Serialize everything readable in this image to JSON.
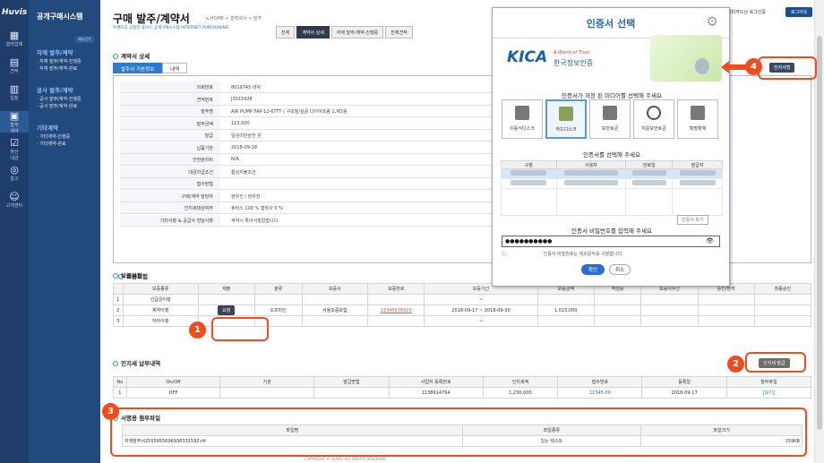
{
  "iconbar": {
    "logo": "Huvis",
    "items": [
      "협력업체",
      "견적",
      "입찰",
      "발주\n계약",
      "정산\n대금",
      "알고",
      "고객센터"
    ]
  },
  "sidenav": {
    "title": "공개구매시스템",
    "menu_btn": "메뉴닫기",
    "groups": [
      {
        "title": "자재 발주/계약",
        "items": [
          "· 자재 발주/계약-진행중",
          "· 자재 발주/계약-완료"
        ]
      },
      {
        "title": "공사 발주/계약",
        "items": [
          "· 공사 발주/계약-진행중",
          "· 공사 발주/계약-완료"
        ]
      },
      {
        "title": "기타계약",
        "items": [
          "· 기타계약-진행중",
          "· 기타계약-완료"
        ]
      }
    ]
  },
  "header": {
    "title": "구매 발주/계약서",
    "breadcrumb": "⌂ HOME > 협력회사 > 발주",
    "subtitle": "투명하고 공정한 휴비스 공개구매시스템 INTERNET PURCHASING",
    "tabs": [
      "전체",
      "계약서 상세",
      "자재 발주/계약-진행중",
      "전체견적"
    ],
    "user": "남미카드님",
    "user_suffix": "로그인중",
    "logout": "로그아웃"
  },
  "detail": {
    "section": "계약서 상세",
    "subtabs": [
      "발주서 기본정보",
      "내역"
    ],
    "rows": [
      {
        "k": "의뢰번호",
        "v": "8019745   내자"
      },
      {
        "k": "견적번호",
        "v": "J2015928"
      },
      {
        "k": "발주명",
        "v": "AIR PUMP FAP-12-6TTT ( 구모빌/실굴 다이아프람 1,제3용"
      },
      {
        "k": "발주금액",
        "v": "123,000"
      },
      {
        "k": "발급",
        "v": "일심이만삼천 원"
      },
      {
        "k": "납품기한",
        "v": "2018-09-18"
      },
      {
        "k": "안전관리비",
        "v": "N/A"
      },
      {
        "k": "대금지급조건",
        "v": "통상지불조건"
      },
      {
        "k": "접수방법",
        "v": ""
      },
      {
        "k": "구매/계약 담당자",
        "v": "현우진 / 현우진"
      },
      {
        "k": "인지세대상여부",
        "v": "휴비스 100 % 협력사 0 %"
      },
      {
        "k": "기타사항 & 공급사 전달사항",
        "v": "계약시 특이사항없습니다."
      }
    ]
  },
  "guarantee": {
    "section": "보증보험",
    "headers": [
      "",
      "보증종류",
      "제출",
      "분류",
      "보증사",
      "보증번호",
      "보증기간",
      "보증금액",
      "작성중",
      "보증서수신",
      "승인/반려",
      "최종승인"
    ],
    "rows": [
      [
        "1",
        "선급금이행",
        "",
        "",
        "",
        "",
        "~",
        "",
        "",
        "",
        "",
        ""
      ],
      [
        "2",
        "계약이행",
        "요청",
        "오프라인",
        "서울보증보험",
        "12345678920",
        "2018-09-17 ~ 2018-09-30",
        "1,023,000",
        "",
        "",
        "",
        ""
      ],
      [
        "3",
        "하자이행",
        "",
        "",
        "",
        "",
        "~",
        "",
        "",
        "",
        "",
        ""
      ]
    ],
    "top_label": "진행상태"
  },
  "stamp": {
    "section": "인지세 납부내역",
    "button": "인지세 발급",
    "headers": [
      "No",
      "On/Off",
      "기관",
      "발급방법",
      "사업자 등록번호",
      "인지세액",
      "접수번호",
      "등록일",
      "첨부파일"
    ],
    "row": [
      "1",
      "OFF",
      "",
      "",
      "1138614764",
      "1,230,000",
      "12345-00",
      "2018-09-17",
      "[보기]"
    ]
  },
  "attach": {
    "section": "서명용 첨부파일",
    "headers": [
      "파일명",
      "파일종류",
      "파일크기"
    ],
    "row": [
      "자재발주서2555855696938331592.rtf",
      "있는 텍스트",
      "159KB"
    ]
  },
  "footer": "COPYRIGHT © HUVIS. ALL RIGHTS RESERVED",
  "modal": {
    "title": "인증서 선택",
    "kica": "KICA",
    "kica_tag": "A World of Trust",
    "kica_name": "한국정보인증",
    "media_label": "인증서가 저장 된 미디어를 선택해 주세요",
    "media": [
      "이동식디스크",
      "하드디스크",
      "보안토큰",
      "지문보안토큰",
      "확장매체"
    ],
    "cert_label": "인증서를 선택해 주세요",
    "cert_headers": [
      "구분",
      "사용자",
      "만료일",
      "발급자"
    ],
    "cert_view": "인증서 보기",
    "pw_label": "인증서 비밀번호를 입력해 주세요",
    "pw_value": "●●●●●●●●●●",
    "pw_info": "인증서 비밀번호는 대소문자를 구분합니다.",
    "ok": "확인",
    "cancel": "취소"
  },
  "right_button": "전자서명",
  "badges": [
    "1",
    "2",
    "3",
    "4"
  ],
  "colors": {
    "accent": "#f04c1e",
    "nav": "#234a7d",
    "primary": "#2b6cd1"
  }
}
